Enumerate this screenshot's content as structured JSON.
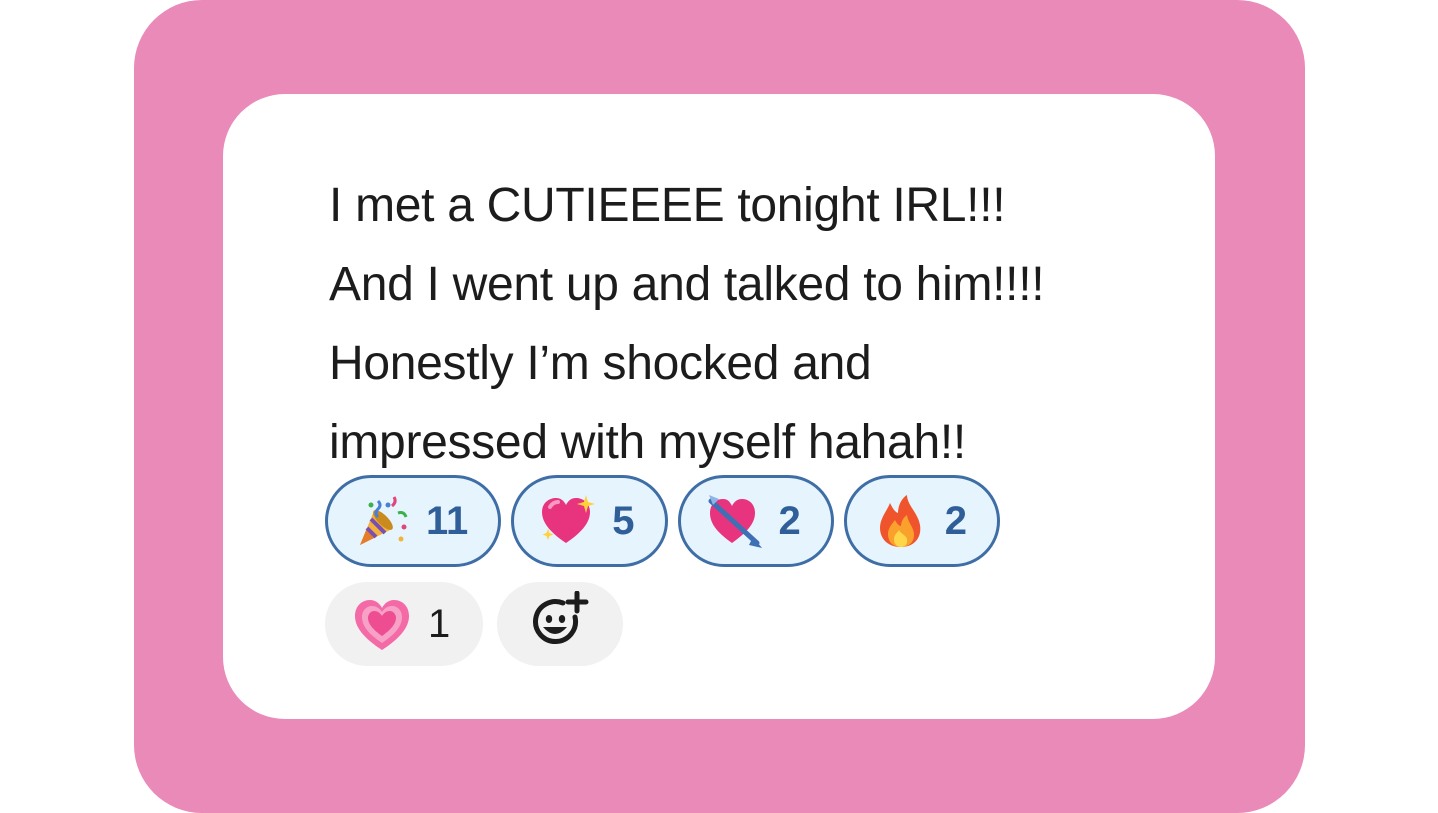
{
  "message": {
    "lines": [
      "I met a CUTIEEEE tonight IRL!!!",
      "And I went up and talked to him!!!!",
      "Honestly I’m shocked and",
      "impressed with myself hahah!!"
    ]
  },
  "reactions": [
    {
      "icon": "party-popper-icon",
      "count": "11",
      "selected": true
    },
    {
      "icon": "sparkling-heart-icon",
      "count": "5",
      "selected": true
    },
    {
      "icon": "heart-with-arrow-icon",
      "count": "2",
      "selected": true
    },
    {
      "icon": "fire-icon",
      "count": "2",
      "selected": true
    },
    {
      "icon": "growing-heart-icon",
      "count": "1",
      "selected": false
    }
  ],
  "add_reaction": {
    "icon": "add-reaction-icon"
  },
  "colors": {
    "frame": "#e98ab9",
    "card": "#ffffff",
    "selected_bg": "#e6f4fd",
    "selected_border": "#3e6ea5",
    "selected_text": "#2f5e98",
    "unselected_bg": "#f1f1f1",
    "text": "#1d1c1d"
  }
}
